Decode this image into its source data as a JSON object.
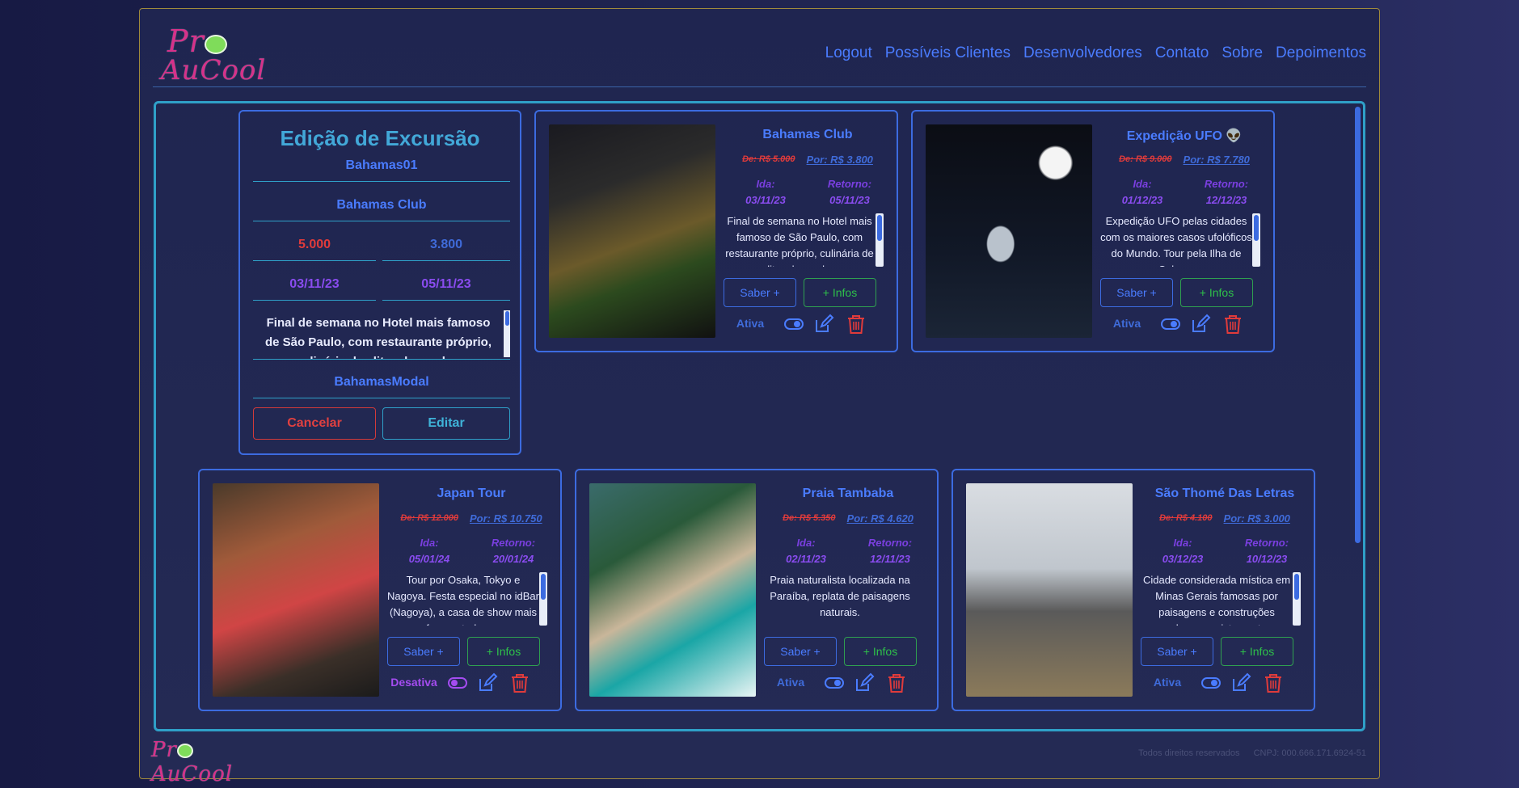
{
  "logo": {
    "line1": "Pr",
    "line2": "AuCool"
  },
  "nav": [
    "Logout",
    "Possíveis Clientes",
    "Desenvolvedores",
    "Contato",
    "Sobre",
    "Depoimentos"
  ],
  "edit": {
    "title": "Edição de Excursão",
    "id": "Bahamas01",
    "name": "Bahamas Club",
    "price_old": "5.000",
    "price_new": "3.800",
    "date_out": "03/11/23",
    "date_back": "05/11/23",
    "description": "Final de semana no Hotel mais famoso de São Paulo, com restaurante próprio, culinária de elite, shows, bar",
    "modal": "BahamasModal",
    "cancel": "Cancelar",
    "submit": "Editar"
  },
  "cards": [
    {
      "title": "Bahamas Club",
      "old": "De: R$ 5.000",
      "new": "Por: R$ 3.800",
      "ida_label": "Ida:",
      "ret_label": "Retorno:",
      "ida": "03/11/23",
      "ret": "05/11/23",
      "desc": "Final de semana no Hotel mais famoso de São Paulo, com restaurante próprio, culinária de elite, shows, bar",
      "saber": "Saber +",
      "infos": "+ Infos",
      "status": "Ativa",
      "icon": "hotel-photo"
    },
    {
      "title": "Expedição UFO 👽",
      "old": "De: R$ 9.000",
      "new": "Por: R$ 7.780",
      "ida_label": "Ida:",
      "ret_label": "Retorno:",
      "ida": "01/12/23",
      "ret": "12/12/23",
      "desc": "Expedição UFO pelas cidades com os maiores casos ufolóficos do Mundo. Tour pela Ilha de Colares",
      "saber": "Saber +",
      "infos": "+ Infos",
      "status": "Ativa",
      "icon": "ufo-photo"
    },
    {
      "title": "Japan Tour",
      "old": "De: R$ 12.000",
      "new": "Por: R$ 10.750",
      "ida_label": "Ida:",
      "ret_label": "Retorno:",
      "ida": "05/01/24",
      "ret": "20/01/24",
      "desc": "Tour por Osaka, Tokyo e Nagoya. Festa especial no idBar (Nagoya), a casa de show mais frequentada por",
      "saber": "Saber +",
      "infos": "+ Infos",
      "status": "Desativa",
      "icon": "osaka-photo"
    },
    {
      "title": "Praia Tambaba",
      "old": "De: R$ 5.350",
      "new": "Por: R$ 4.620",
      "ida_label": "Ida:",
      "ret_label": "Retorno:",
      "ida": "02/11/23",
      "ret": "12/11/23",
      "desc": "Praia naturalista localizada na Paraíba, replata de paisagens naturais.",
      "saber": "Saber +",
      "infos": "+ Infos",
      "status": "Ativa",
      "icon": "beach-photo"
    },
    {
      "title": "São Thomé Das Letras",
      "old": "De: R$ 4.100",
      "new": "Por: R$ 3.000",
      "ida_label": "Ida:",
      "ret_label": "Retorno:",
      "ida": "03/12/23",
      "ret": "10/12/23",
      "desc": "Cidade considerada mística em Minas Gerais famosas por paisagens e construções rochosas, avistamentos",
      "saber": "Saber +",
      "infos": "+ Infos",
      "status": "Ativa",
      "icon": "sign-photo"
    }
  ],
  "footer": {
    "rights": "Todos direitos reservados",
    "cnpj": "CNPJ: 000.666.171.6924-51"
  },
  "colors": {
    "accent": "#4a7cff",
    "border": "#3c6be0",
    "danger": "#e03b3b",
    "success": "#2ec04a",
    "date": "#8a4cf0"
  }
}
